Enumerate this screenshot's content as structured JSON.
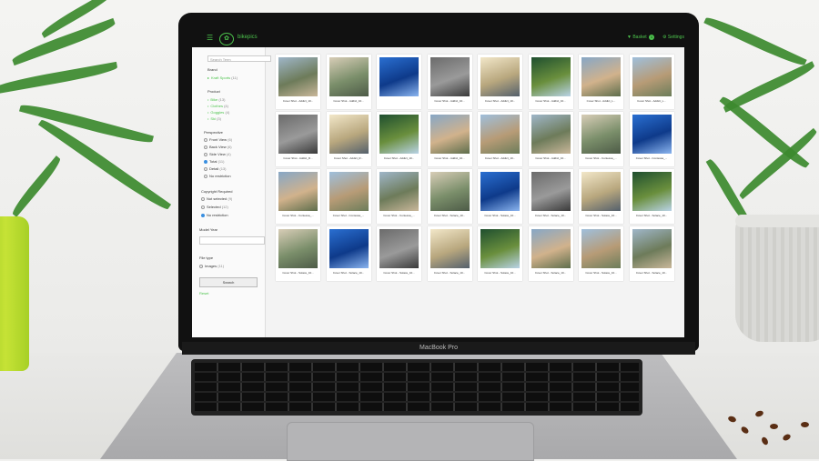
{
  "device": {
    "brand_label": "MacBook Pro"
  },
  "app": {
    "menu_icon": "menu-icon",
    "title": "bikepics",
    "basket_label": "Basket",
    "basket_count": "1",
    "settings_label": "Settings"
  },
  "sidebar": {
    "search_placeholder": "Search Term",
    "brand_heading": "Brand",
    "brand_item": "Kraft Sports",
    "brand_count": "(11)",
    "product_heading": "Product",
    "products": [
      {
        "label": "Bike",
        "count": "(13)"
      },
      {
        "label": "Clothes",
        "count": "(4)"
      },
      {
        "label": "Goggles",
        "count": "(4)"
      },
      {
        "label": "Ski",
        "count": "(3)"
      }
    ],
    "perspective_heading": "Perspective",
    "perspectives": [
      {
        "label": "Front View",
        "count": "(6)",
        "selected": false
      },
      {
        "label": "Back View",
        "count": "(6)",
        "selected": false
      },
      {
        "label": "Side View",
        "count": "(4)",
        "selected": false
      },
      {
        "label": "Total",
        "count": "(11)",
        "selected": true
      },
      {
        "label": "Detail",
        "count": "(13)",
        "selected": false
      },
      {
        "label": "No restriction",
        "count": "",
        "selected": false
      }
    ],
    "copyright_heading": "Copyright Required",
    "copyright": [
      {
        "label": "Not selected",
        "count": "(9)",
        "selected": false
      },
      {
        "label": "Selected",
        "count": "(12)",
        "selected": false
      },
      {
        "label": "No restriction",
        "count": "",
        "selected": true
      }
    ],
    "model_year_heading": "Model Year",
    "filetype_heading": "File type",
    "filetype_item": "Images",
    "filetype_count": "(11)",
    "search_button": "Search",
    "reset_link": "Reset"
  },
  "grid": {
    "rows": [
      [
        "Cover Shot - Addict_10...",
        "Cover Shot - Addict_10...",
        "",
        "Cover Shot - Addict_10...",
        "Cover Shot - Addict_10...",
        "Cover Shot - Addict_10...",
        "Cover Shot - Addict_L...",
        "Cover Shot - Addict_L..."
      ],
      [
        "Cover Shot - Addict_R...",
        "Cover Shot - Addict_R...",
        "Cover Shot - Addict_10...",
        "Cover Shot - Addict_10...",
        "Cover Shot - Addict_10...",
        "Cover Shot - Addict_10...",
        "Cover Shot - Contessa_...",
        "Cover Shot - Contessa_..."
      ],
      [
        "Cover Shot - Contessa_...",
        "Cover Shot - Contessa_...",
        "Cover Shot - Contessa_...",
        "Cover Shot - Solace_10...",
        "Cover Shot - Solace_10...",
        "Cover Shot - Solace_10...",
        "Cover Shot - Solace_10...",
        "Cover Shot - Solace_10..."
      ],
      [
        "Cover Shot - Solace_10...",
        "Cover Shot - Solace_10...",
        "Cover Shot - Solace_10...",
        "Cover Shot - Solace_10...",
        "Cover Shot - Solace_10...",
        "Cover Shot - Solace_10...",
        "Cover Shot - Solace_10...",
        "Cover Shot - Solace_10..."
      ]
    ]
  },
  "colors": {
    "accent": "#4cc34c",
    "topbar": "#111111",
    "selected_radio": "#3a8fe0"
  }
}
